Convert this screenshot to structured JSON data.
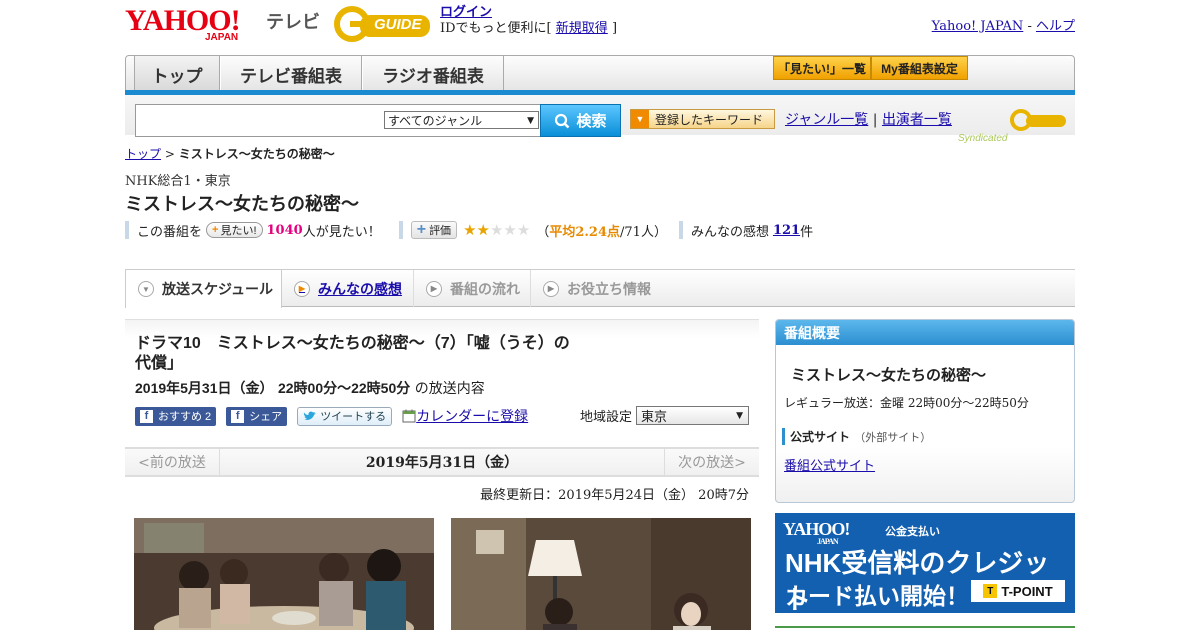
{
  "header": {
    "yahoo_word": "YAHOO!",
    "yahoo_sub": "JAPAN",
    "service_name": "テレビ",
    "gguide_word": "GUIDE",
    "login_label": "ログイン",
    "id_promo": "IDでもっと便利に[",
    "signup_label": "新規取得",
    "id_promo_end": "]",
    "yahoo_japan_link": "Yahoo! JAPAN",
    "separator": "-",
    "help_link": "ヘルプ"
  },
  "nav": {
    "tabs": [
      "トップ",
      "テレビ番組表",
      "ラジオ番組表"
    ],
    "mitai_list": "「見たい!」一覧",
    "my_schedule": "My番組表設定"
  },
  "search": {
    "genre_selected": "すべてのジャンル",
    "button_label": "検索",
    "keyword_button": "登録したキーワード",
    "genre_list_link": "ジャンル一覧",
    "divider": "|",
    "performer_link": "出演者一覧",
    "syndicated": "Syndicated"
  },
  "breadcrumb": {
    "top": "トップ",
    "sep": ">",
    "current": "ミストレス～女たちの秘密～"
  },
  "program": {
    "channel": "NHK総合1・東京",
    "title": "ミストレス～女たちの秘密～",
    "mitai_prefix": "この番組を",
    "mitai_button": "見たい!",
    "mitai_count": "1040",
    "mitai_suffix": "人が見たい！",
    "rate_button": "評価",
    "stars_filled": 2,
    "stars_total": 5,
    "avg_prefix": "（",
    "avg_label": "平均2.24点",
    "avg_count": "/71人）",
    "review_prefix": "みんなの感想",
    "review_count": "121",
    "review_suffix": "件"
  },
  "tabs": [
    {
      "label": "放送スケジュール",
      "state": "active"
    },
    {
      "label": "みんなの感想",
      "state": "link"
    },
    {
      "label": "番組の流れ",
      "state": "disabled"
    },
    {
      "label": "お役立ち情報",
      "state": "disabled"
    }
  ],
  "episode": {
    "title": "ドラマ10　ミストレス～女たちの秘密～（7）「嘘（うそ）の代償」",
    "date": "2019年5月31日（金）",
    "time": "22時00分～22時50分",
    "date_suffix": "の放送内容",
    "fb_recommend": "おすすめ 2",
    "fb_share": "シェア",
    "tweet": "ツイートする",
    "calendar": "カレンダーに登録",
    "region_label": "地域設定",
    "region_value": "東京"
  },
  "day_nav": {
    "prev": "<前の放送",
    "current": "2019年5月31日（金）",
    "next": "次の放送>"
  },
  "updated": "最終更新日：2019年5月24日（金）  20時7分",
  "sidebar": {
    "header": "番組概要",
    "title": "ミストレス～女たちの秘密～",
    "regular": "レギュラー放送：金曜 22時00分～22時50分",
    "official_label": "公式サイト",
    "official_note": "（外部サイト）",
    "official_link": "番組公式サイト"
  },
  "ad": {
    "brand": "YAHOO!",
    "brand_sub": "JAPAN",
    "tag": "公金支払い",
    "line1": "NHK受信料のクレジット",
    "line2": "カード払い開始！",
    "tpoint": "T-POINT"
  },
  "colors": {
    "yahoo_red": "#e60012",
    "nav_blue": "#1a8bd0",
    "accent_orange": "#f08a00",
    "pink": "#e4007f"
  }
}
